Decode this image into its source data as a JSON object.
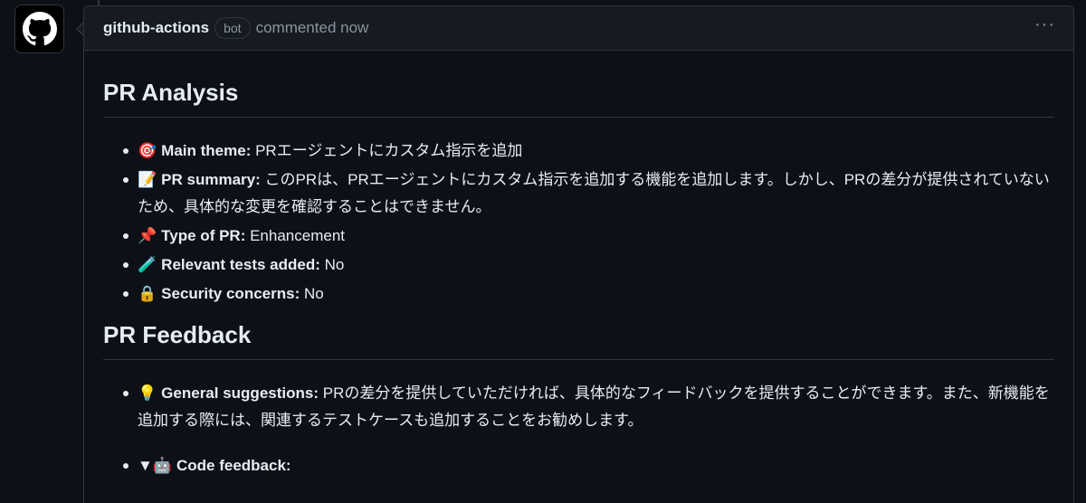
{
  "header": {
    "author": "github-actions",
    "badge": "bot",
    "action": "commented now",
    "menu": "···"
  },
  "analysis": {
    "title": "PR Analysis",
    "items": [
      {
        "emoji": "🎯",
        "label": "Main theme:",
        "text": "PRエージェントにカスタム指示を追加"
      },
      {
        "emoji": "📝",
        "label": "PR summary:",
        "text": "このPRは、PRエージェントにカスタム指示を追加する機能を追加します。しかし、PRの差分が提供されていないため、具体的な変更を確認することはできません。"
      },
      {
        "emoji": "📌",
        "label": "Type of PR:",
        "text": "Enhancement"
      },
      {
        "emoji": "🧪",
        "label": "Relevant tests added:",
        "text": "No"
      },
      {
        "emoji": "🔒",
        "label": "Security concerns:",
        "text": "No"
      }
    ]
  },
  "feedback": {
    "title": "PR Feedback",
    "items": [
      {
        "emoji": "💡",
        "label": "General suggestions:",
        "text": "PRの差分を提供していただければ、具体的なフィードバックを提供することができます。また、新機能を追加する際には、関連するテストケースも追加することをお勧めします。"
      },
      {
        "toggle": "▼",
        "emoji": "🤖",
        "label": "Code feedback:",
        "text": ""
      }
    ]
  }
}
